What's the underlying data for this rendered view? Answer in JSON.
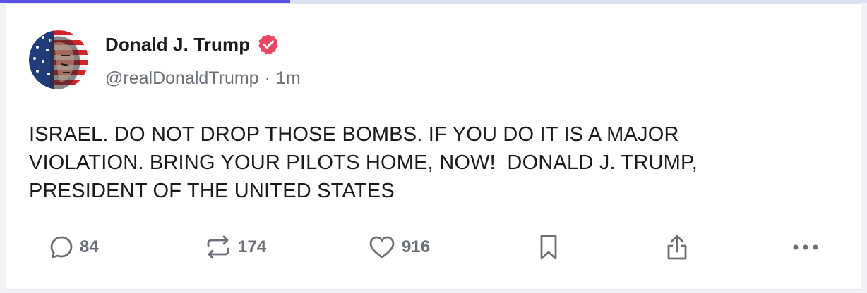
{
  "progress": {
    "fraction": 0.335,
    "fill_color": "#5a52e0",
    "track_color": "#dde0f5"
  },
  "post": {
    "author": {
      "display_name": "Donald J. Trump",
      "verified": true,
      "verified_color": "#ec4863",
      "handle": "@realDonaldTrump",
      "separator": "·",
      "time": "1m",
      "avatar": "american-flag-portrait-avatar"
    },
    "text": "ISRAEL. DO NOT DROP THOSE BOMBS. IF YOU DO IT IS A MAJOR\nVIOLATION. BRING YOUR PILOTS HOME, NOW!  DONALD J. TRUMP,\nPRESIDENT OF THE UNITED STATES"
  },
  "actions": {
    "reply": {
      "icon": "reply-icon",
      "count": "84"
    },
    "retruth": {
      "icon": "retruth-icon",
      "count": "174"
    },
    "like": {
      "icon": "heart-icon",
      "count": "916"
    },
    "bookmark": {
      "icon": "bookmark-icon"
    },
    "share": {
      "icon": "share-icon"
    },
    "more": {
      "icon": "more-icon"
    }
  }
}
